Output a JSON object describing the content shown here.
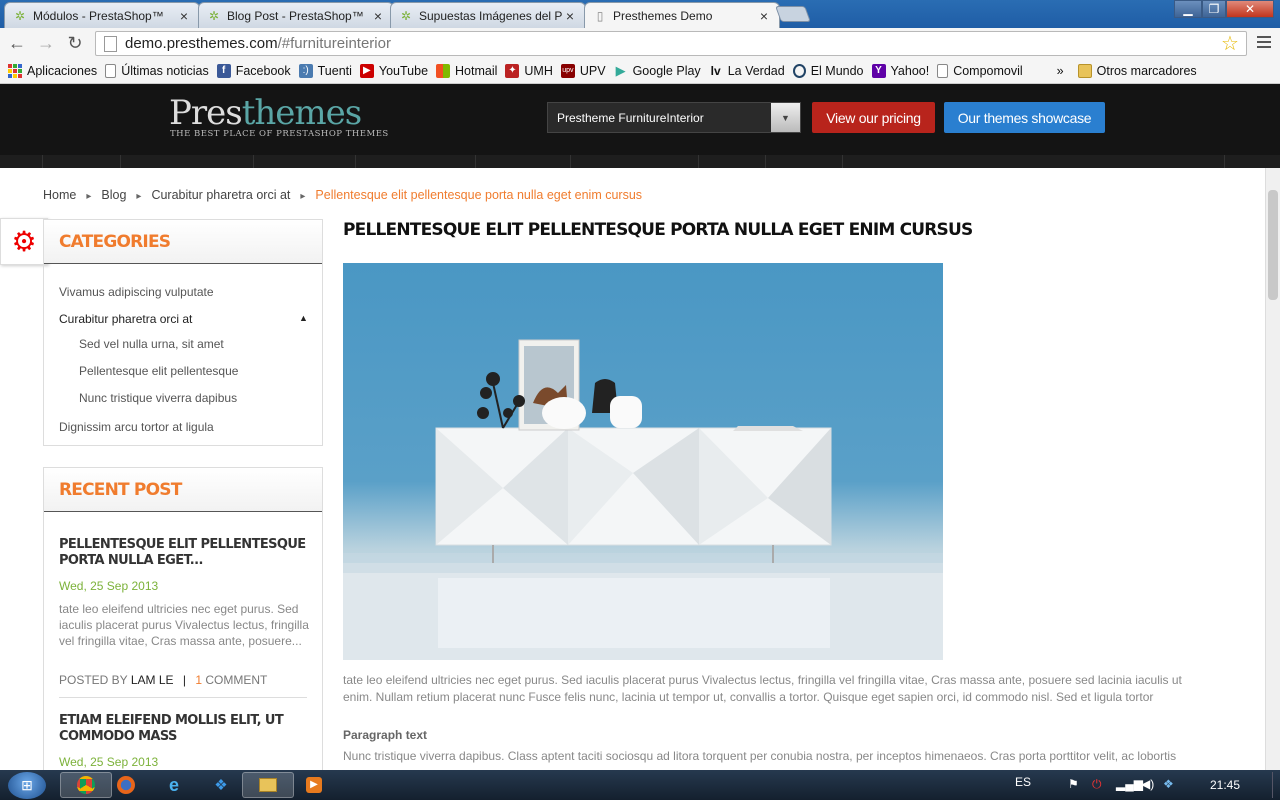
{
  "browser": {
    "tabs": [
      {
        "title": "Módulos - PrestaShop™",
        "icon": "prestashop-icon"
      },
      {
        "title": "Blog Post - PrestaShop™",
        "icon": "prestashop-icon"
      },
      {
        "title": "Supuestas Imágenes del P",
        "icon": "prestashop-icon"
      },
      {
        "title": "Presthemes Demo",
        "icon": "page-icon",
        "active": true
      }
    ],
    "url_host": "demo.presthemes.com",
    "url_path": "/#furnitureinterior",
    "bookmarks": [
      {
        "label": "Aplicaciones",
        "icon": "apps-icon"
      },
      {
        "label": "Últimas noticias",
        "icon": "page-icon"
      },
      {
        "label": "Facebook",
        "icon": "facebook-icon"
      },
      {
        "label": "Tuenti",
        "icon": "tuenti-icon"
      },
      {
        "label": "YouTube",
        "icon": "youtube-icon"
      },
      {
        "label": "Hotmail",
        "icon": "windows-icon"
      },
      {
        "label": "UMH",
        "icon": "umh-icon"
      },
      {
        "label": "UPV",
        "icon": "upv-icon"
      },
      {
        "label": "Google Play",
        "icon": "play-icon"
      },
      {
        "label": "La Verdad",
        "icon": "lv-icon"
      },
      {
        "label": "El Mundo",
        "icon": "elmundo-icon"
      },
      {
        "label": "Yahoo!",
        "icon": "yahoo-icon"
      },
      {
        "label": "Compomovil",
        "icon": "page-icon"
      }
    ],
    "bookmarks_more": "»",
    "other_bookmarks": "Otros marcadores"
  },
  "site": {
    "logo_pres": "Pres",
    "logo_themes": "themes",
    "tagline": "THE BEST PLACE OF PRESTASHOP THEMES",
    "theme_select": "Presthemе FurnitureInterior",
    "pricing_btn": "View our pricing",
    "showcase_btn": "Our themes showcase",
    "colors": {
      "pricing": "#b8241c",
      "showcase": "#2a7fd0",
      "accent": "#f07c2e",
      "date": "#7cb23a"
    }
  },
  "breadcrumb": [
    "Home",
    "Blog",
    "Curabitur pharetra orci at",
    "Pellentesque elit pellentesque porta nulla eget enim cursus"
  ],
  "categories": {
    "title": "CATEGORIES",
    "items": [
      {
        "label": "Vivamus adipiscing vulputate"
      },
      {
        "label": "Curabitur pharetra orci at",
        "open": true
      },
      {
        "label": "Sed vel nulla urna, sit amet",
        "sub": true
      },
      {
        "label": "Pellentesque elit pellentesque",
        "sub": true
      },
      {
        "label": "Nunc tristique viverra dapibus",
        "sub": true
      },
      {
        "label": "Dignissim arcu tortor at ligula"
      }
    ]
  },
  "recent": {
    "title": "RECENT POST",
    "posts": [
      {
        "title": "PELLENTESQUE ELIT PELLENTESQUE PORTA NULLA EGET...",
        "date": "Wed, 25 Sep 2013",
        "excerpt": "tate leo eleifend ultricies nec eget purus. Sed iaculis placerat purus Vivalectus lectus, fringilla vel fringilla vitae, Cras massa ante, posuere...",
        "posted_by": "POSTED BY",
        "author": "LAM LE",
        "sep": "|",
        "comments_n": "1",
        "comments_label": "COMMENT"
      },
      {
        "title": "ETIAM ELEIFEND MOLLIS ELIT, UT COMMODO MASS",
        "date": "Wed, 25 Sep 2013"
      }
    ]
  },
  "article": {
    "title": "PELLENTESQUE ELIT PELLENTESQUE PORTA NULLA EGET ENIM CURSUS",
    "body": "tate leo eleifend ultricies nec eget purus. Sed iaculis placerat purus Vivalectus lectus, fringilla vel fringilla vitae, Cras massa ante, posuere sed lacinia iaculis ut enim. Nullam retium placerat nunc Fusce felis nunc, lacinia ut tempor ut, convallis a tortor. Quisque eget sapien orci, id commodo nisl. Sed et ligula tortor",
    "para_heading": "Paragraph text",
    "body2": "Nunc tristique viverra dapibus. Class aptent taciti sociosqu ad litora torquent per conubia nostra, per inceptos himenaeos. Cras porta porttitor velit, ac lobortis"
  },
  "taskbar": {
    "lang": "ES",
    "time": "21:45"
  }
}
